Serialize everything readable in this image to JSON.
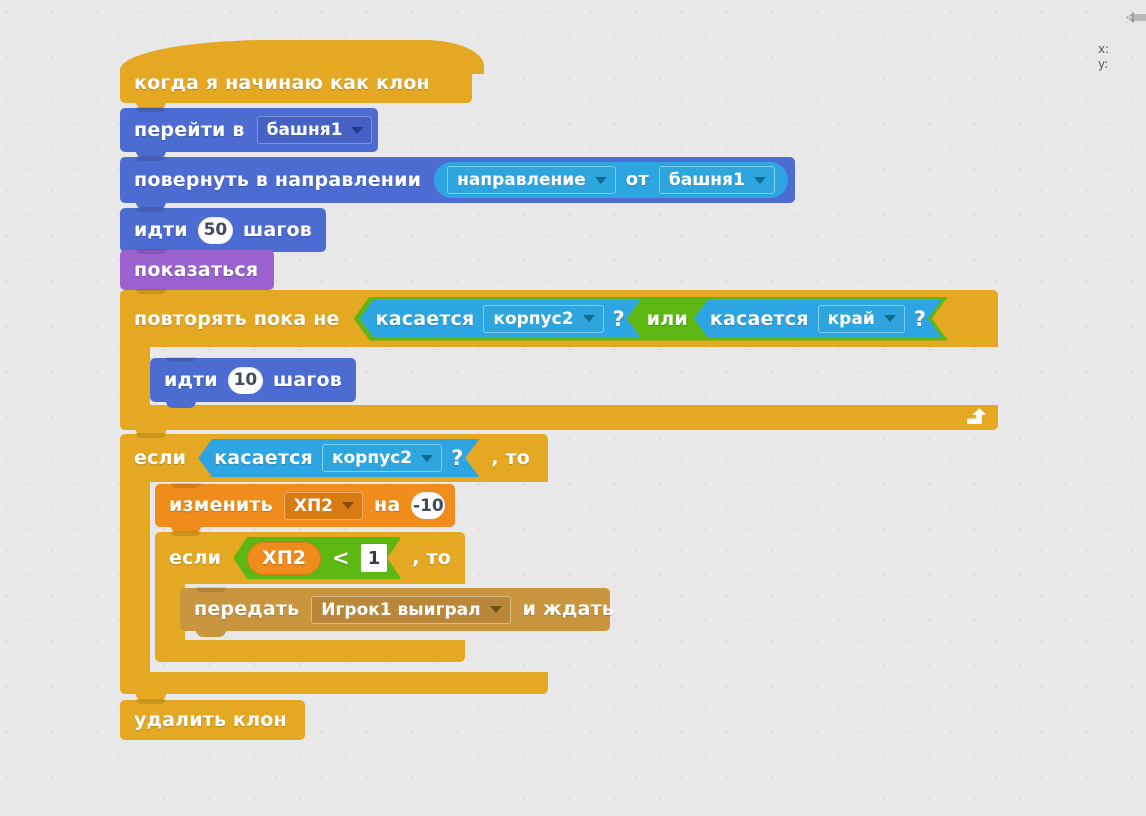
{
  "workspace": {
    "background": "#e8e8e8",
    "hud": {
      "x_label": "x:",
      "y_label": "y:",
      "icon": "cursor-pointer-icon"
    }
  },
  "palette": {
    "control": "#e5a822",
    "motion": "#4c6cd1",
    "looks": "#9a61cf",
    "sensing": "#2ca5e2",
    "operators": "#5cb712",
    "data": "#f08c1b",
    "events": "#c9963f"
  },
  "script": {
    "hat": {
      "label": "когда я начинаю как клон"
    },
    "goto": {
      "label": "перейти в",
      "target": "башня1"
    },
    "point_towards": {
      "label": "повернуть в направлении",
      "property": "направление",
      "of_label": "от",
      "object": "башня1"
    },
    "move_outer": {
      "label_before": "идти",
      "steps": "50",
      "label_after": "шагов"
    },
    "show": {
      "label": "показаться"
    },
    "repeat_until": {
      "label": "повторять пока не",
      "condition": {
        "operator_label": "или",
        "left": {
          "label": "касается",
          "target": "корпус2",
          "question": "?"
        },
        "right": {
          "label": "касается",
          "target": "край",
          "question": "?"
        }
      },
      "body": {
        "move": {
          "label_before": "идти",
          "steps": "10",
          "label_after": "шагов"
        }
      }
    },
    "if_touching": {
      "label": "если",
      "then_label": ", то",
      "condition": {
        "label": "касается",
        "target": "корпус2",
        "question": "?"
      },
      "body": {
        "change_var": {
          "label_before": "изменить",
          "variable": "ХП2",
          "label_mid": "на",
          "value": "-10"
        },
        "if_less": {
          "label": "если",
          "then_label": ", то",
          "condition": {
            "variable": "ХП2",
            "comparator": "<",
            "value": "1"
          },
          "body": {
            "broadcast": {
              "label_before": "передать",
              "message": "Игрок1 выиграл",
              "label_after": "и ждать"
            }
          }
        }
      }
    },
    "delete_clone": {
      "label": "удалить клон"
    }
  }
}
